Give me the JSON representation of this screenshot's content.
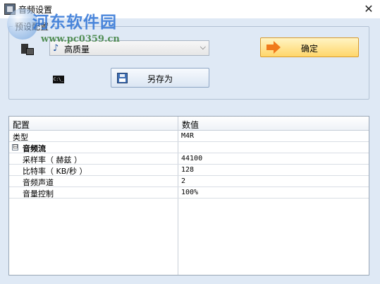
{
  "window": {
    "title": "音频设置",
    "close_glyph": "✕"
  },
  "watermark": {
    "title": "河东软件园",
    "url": "www.pc0359.cn"
  },
  "preset_group": {
    "legend": "预设配置",
    "selected_preset": "高质量",
    "ok_label": "确定",
    "save_as_label": "另存为",
    "cmd_icon_text": "C:\\_"
  },
  "properties": {
    "columns": [
      "配置",
      "数值"
    ],
    "type_row": {
      "name": "类型",
      "value": "M4R"
    },
    "category": {
      "toggle": "⊟",
      "name": "音频流"
    },
    "items": [
      {
        "name": "采样率（ 赫兹 ）",
        "value": "44100"
      },
      {
        "name": "比特率（ KB/秒 ）",
        "value": "128"
      },
      {
        "name": "音频声道",
        "value": "2"
      },
      {
        "name": "音量控制",
        "value": "100%"
      }
    ]
  },
  "colors": {
    "window_bg": "#dfe9f5",
    "ok_button": "#ffd66a",
    "watermark_blue": "#2f74d6",
    "watermark_green": "#3a7f3a"
  },
  "icons": [
    "app-icon",
    "close-icon",
    "preset-icon",
    "music-note-icon",
    "chevron-down-icon",
    "arrow-right-icon",
    "cmd-icon",
    "save-disk-icon",
    "collapse-icon"
  ]
}
